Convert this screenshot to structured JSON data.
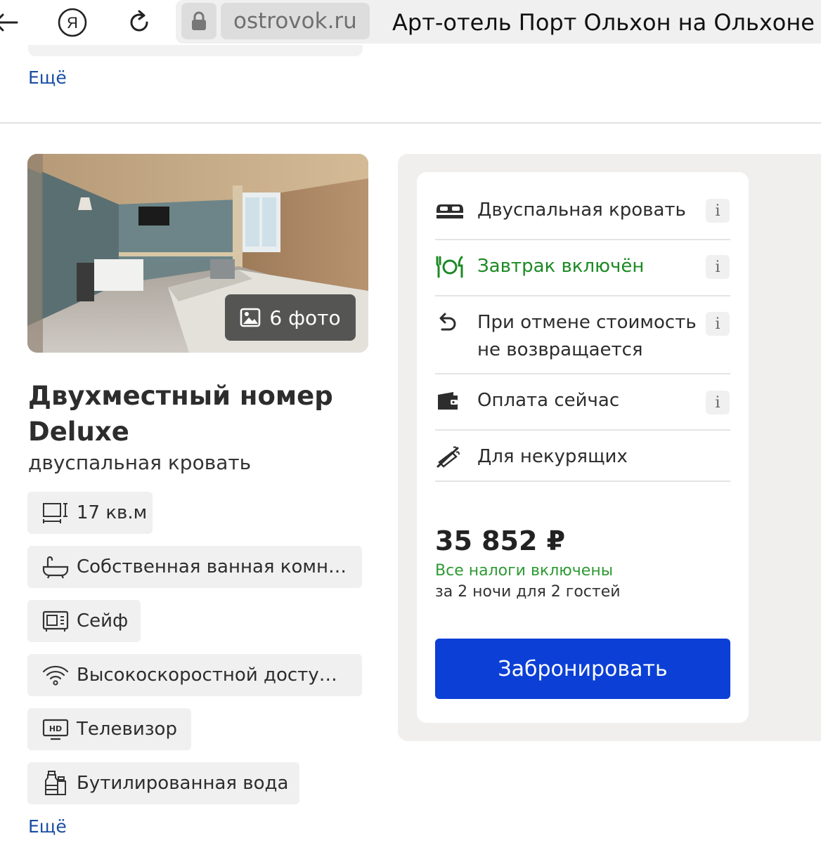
{
  "browser": {
    "domain": "ostrovok.ru",
    "page_title": "Арт-отель Порт Ольхон на Ольхоне от",
    "yandex_letter": "Я"
  },
  "top": {
    "more_link": "Ещё"
  },
  "room": {
    "photo_button": "6 фото",
    "title": "Двухместный номер Deluxe",
    "subtitle": "двуспальная кровать",
    "amenities": [
      {
        "icon": "room-size-icon",
        "label": "17 кв.м"
      },
      {
        "icon": "bathtub-icon",
        "label": "Собственная ванная комн…"
      },
      {
        "icon": "safe-icon",
        "label": "Сейф"
      },
      {
        "icon": "wifi-icon",
        "label": "Высокоскоростной досту…"
      },
      {
        "icon": "tv-icon",
        "label": "Телевизор"
      },
      {
        "icon": "bottled-water-icon",
        "label": "Бутилированная вода"
      }
    ],
    "more_link": "Ещё"
  },
  "rate": {
    "features": [
      {
        "icon": "bed-icon",
        "label": "Двуспальная кровать",
        "highlight": false,
        "has_info": true
      },
      {
        "icon": "breakfast-icon",
        "label": "Завтрак включён",
        "highlight": true,
        "has_info": true
      },
      {
        "icon": "cancel-return-icon",
        "label": "При отмене стоимость не возвращается",
        "highlight": false,
        "has_info": true
      },
      {
        "icon": "wallet-icon",
        "label": "Оплата сейчас",
        "highlight": false,
        "has_info": true
      },
      {
        "icon": "no-smoking-icon",
        "label": "Для некурящих",
        "highlight": false,
        "has_info": false
      }
    ],
    "info_glyph": "i",
    "price": "35 852 ₽",
    "taxes_note": "Все налоги включены",
    "stay_note": "за 2 ночи для 2 гостей",
    "book_button": "Забронировать"
  },
  "colors": {
    "link": "#1a4ea3",
    "green": "#1c8a24",
    "button": "#0c3fd6",
    "panel_bg": "#f0efed",
    "chip_bg": "#f0f0f0"
  }
}
